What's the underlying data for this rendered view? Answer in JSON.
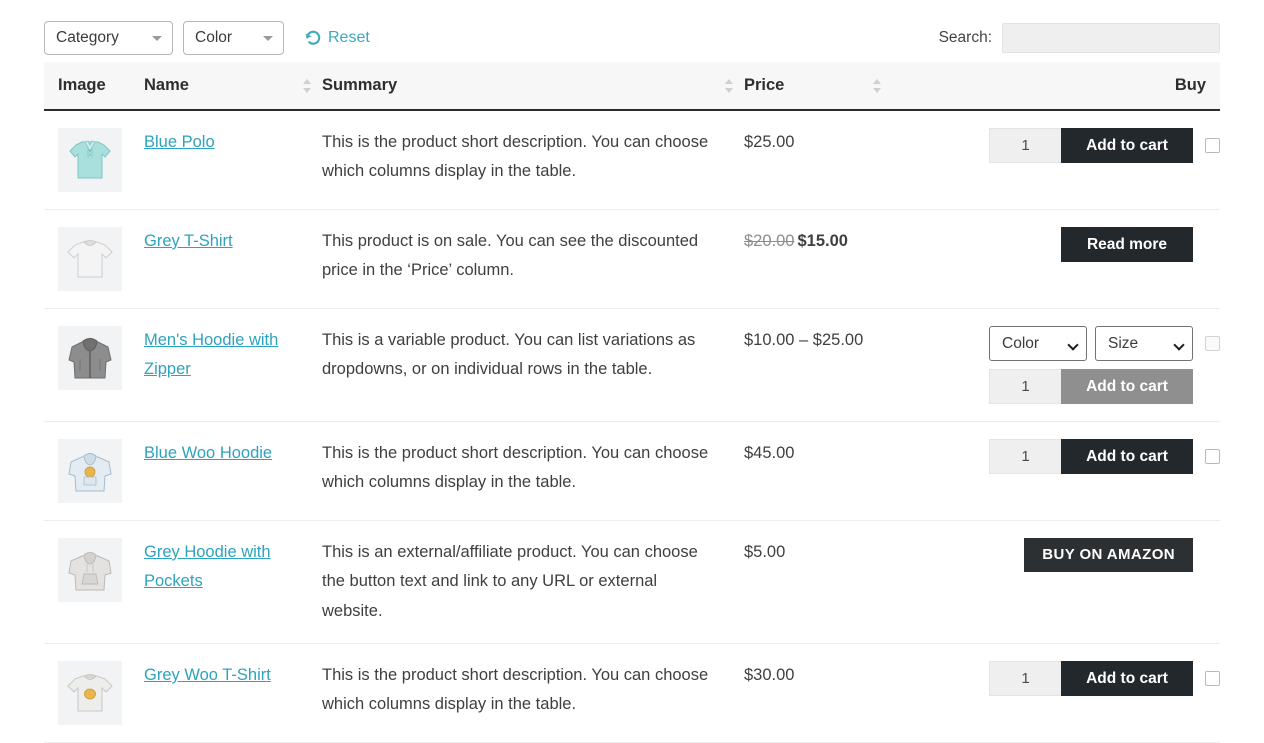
{
  "toolbar": {
    "category_filter": {
      "label": "Category",
      "icon": "chevron-down-icon"
    },
    "color_filter": {
      "label": "Color",
      "icon": "chevron-down-icon"
    },
    "reset": {
      "label": "Reset",
      "icon": "reset-arrow-icon",
      "color": "#3ea8bd"
    }
  },
  "search": {
    "label": "Search:",
    "value": "",
    "placeholder": ""
  },
  "table": {
    "columns": [
      {
        "key": "image",
        "label": "Image",
        "sortable": false
      },
      {
        "key": "name",
        "label": "Name",
        "sortable": true
      },
      {
        "key": "summary",
        "label": "Summary",
        "sortable": true
      },
      {
        "key": "price",
        "label": "Price",
        "sortable": true
      },
      {
        "key": "buy",
        "label": "Buy",
        "sortable": false
      }
    ],
    "rows": [
      {
        "image_alt": "blue-polo-shirt-thumbnail",
        "name": "Blue Polo",
        "summary": "This is the product short description. You can choose which columns display in the table.",
        "price": "$25.00",
        "buy": {
          "type": "simple",
          "quantity": "1",
          "button_label": "Add to cart",
          "checkbox": true,
          "disabled": false
        }
      },
      {
        "image_alt": "grey-tshirt-thumbnail",
        "name": "Grey T-Shirt",
        "summary": "This product is on sale. You can see the discounted price in the ‘Price’ column.",
        "price_regular": "$20.00",
        "price_sale": "$15.00",
        "buy": {
          "type": "read_more",
          "button_label": "Read more",
          "checkbox": false,
          "disabled": false
        }
      },
      {
        "image_alt": "mens-grey-hoodie-with-zipper-thumbnail",
        "name": "Men's Hoodie with Zipper",
        "summary": "This is a variable product. You can list variations as dropdowns, or on individual rows in the table.",
        "price": "$10.00 – $25.00",
        "buy": {
          "type": "variable",
          "variations": [
            {
              "name": "color",
              "label": "Color"
            },
            {
              "name": "size",
              "label": "Size"
            }
          ],
          "quantity": "1",
          "button_label": "Add to cart",
          "checkbox": true,
          "disabled": true
        }
      },
      {
        "image_alt": "blue-woo-hoodie-thumbnail",
        "name": "Blue Woo Hoodie",
        "summary": "This is the product short description. You can choose which columns display in the table.",
        "price": "$45.00",
        "buy": {
          "type": "simple",
          "quantity": "1",
          "button_label": "Add to cart",
          "checkbox": true,
          "disabled": false
        }
      },
      {
        "image_alt": "grey-hoodie-with-pockets-thumbnail",
        "name": "Grey Hoodie with Pockets",
        "summary": "This is an external/affiliate product. You can choose the button text and link to any URL or external website.",
        "price": "$5.00",
        "buy": {
          "type": "external",
          "button_label": "BUY ON AMAZON",
          "checkbox": false,
          "disabled": false
        }
      },
      {
        "image_alt": "grey-woo-tshirt-thumbnail",
        "name": "Grey Woo T-Shirt",
        "summary": "This is the product short description. You can choose which columns display in the table.",
        "price": "$30.00",
        "buy": {
          "type": "simple",
          "quantity": "1",
          "button_label": "Add to cart",
          "checkbox": true,
          "disabled": false
        }
      }
    ]
  },
  "colors": {
    "link": "#2ea3bd",
    "button": "#23282d",
    "button_disabled": "#8f8f8f",
    "header_rule": "#2b2b2b",
    "thumb_bg": "#f1f3f4"
  }
}
